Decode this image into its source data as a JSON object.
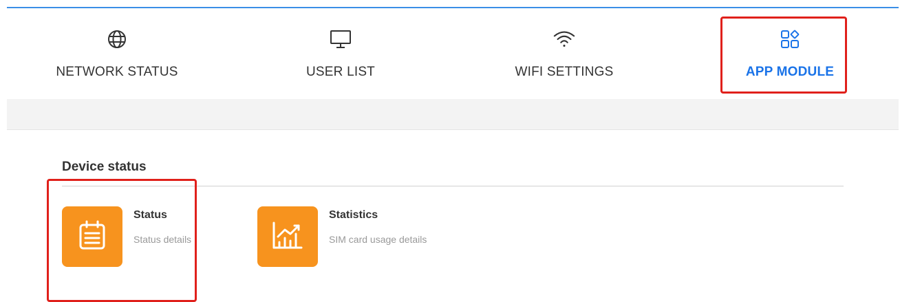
{
  "nav": {
    "items": [
      {
        "label": "NETWORK STATUS",
        "icon": "globe-icon"
      },
      {
        "label": "USER LIST",
        "icon": "monitor-icon"
      },
      {
        "label": "WIFI SETTINGS",
        "icon": "wifi-icon"
      },
      {
        "label": "APP MODULE",
        "icon": "apps-grid-icon",
        "active": true
      }
    ]
  },
  "section": {
    "title": "Device status"
  },
  "cards": [
    {
      "title": "Status",
      "description": "Status details",
      "icon": "clipboard-list-icon"
    },
    {
      "title": "Statistics",
      "description": "SIM card usage details",
      "icon": "chart-icon"
    }
  ],
  "colors": {
    "accent": "#1a73e8",
    "tile": "#f7931e",
    "highlight": "#e0201b",
    "topline": "#3a8ee6"
  }
}
